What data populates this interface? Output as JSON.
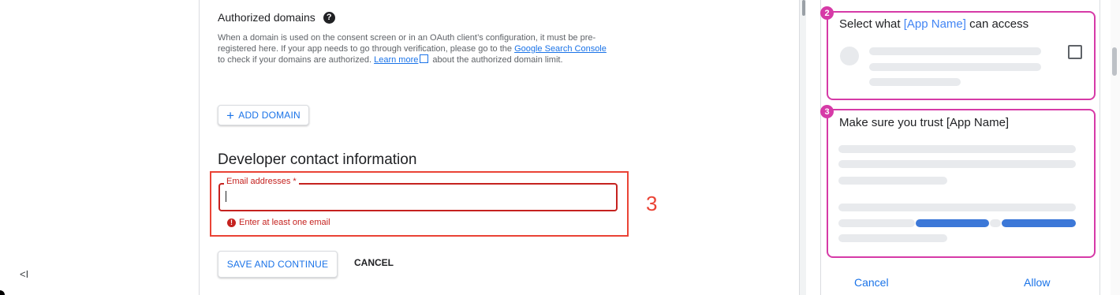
{
  "sidebar": {
    "collapse_label": "<I"
  },
  "authorized_domains": {
    "heading": "Authorized domains",
    "help_icon": "?",
    "desc_part1": "When a domain is used on the consent screen or in an OAuth client’s configuration, it must be pre-registered here. If your app needs to go through verification, please go to the ",
    "link_search_console": "Google Search Console ",
    "desc_part2": "to check if your domains are authorized. ",
    "link_learn_more": "Learn more",
    "desc_part3": " about the authorized domain limit.",
    "add_button_icon": "+",
    "add_button_label": "ADD DOMAIN"
  },
  "developer_contact": {
    "heading": "Developer contact information",
    "email_label": "Email addresses *",
    "email_value": "",
    "error_icon": "!",
    "error_text": "Enter at least one email",
    "annotation_number": "3"
  },
  "actions": {
    "save_label": "SAVE AND CONTINUE",
    "cancel_label": "CANCEL"
  },
  "consent_preview": {
    "card2": {
      "badge": "2",
      "title_prefix": "Select what ",
      "app_name": "[App Name]",
      "title_suffix": " can access"
    },
    "card3": {
      "badge": "3",
      "title": "Make sure you trust [App Name]"
    },
    "cancel_label": "Cancel",
    "allow_label": "Allow"
  },
  "colors": {
    "accent": "#1a73e8",
    "error": "#c5221f",
    "annotation": "#d63aa7"
  }
}
